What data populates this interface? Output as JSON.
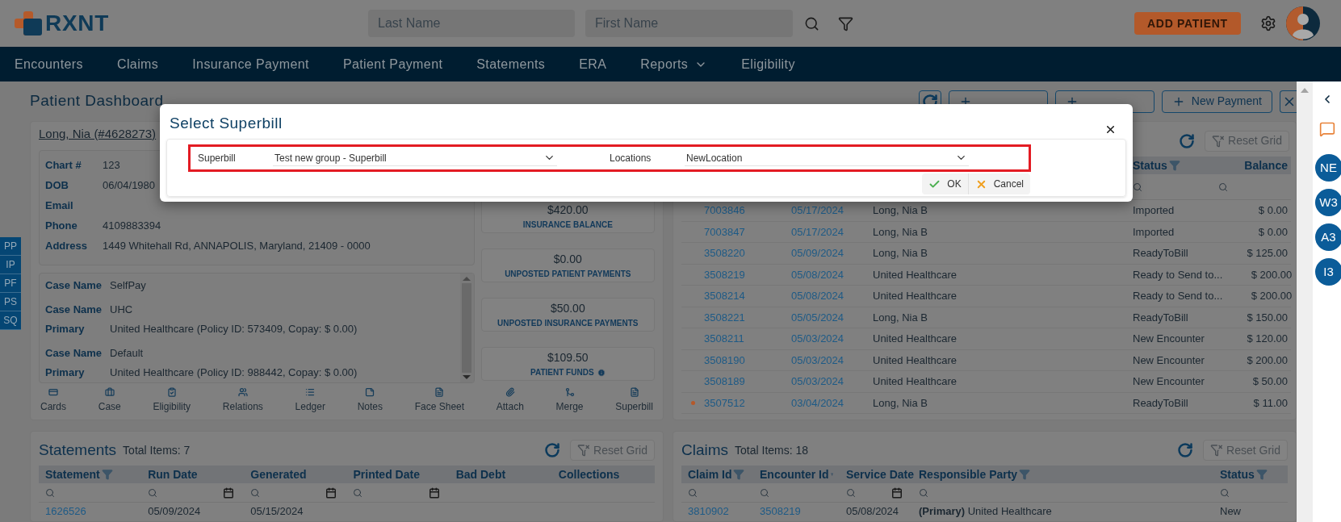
{
  "header": {
    "logo": "RXNT",
    "last_name": {
      "placeholder": "Last Name"
    },
    "first_name": {
      "placeholder": "First Name"
    },
    "add_patient": "ADD PATIENT"
  },
  "nav": [
    {
      "label": "Encounters",
      "dropdown": false
    },
    {
      "label": "Claims",
      "dropdown": false
    },
    {
      "label": "Insurance Payment",
      "dropdown": false
    },
    {
      "label": "Patient Payment",
      "dropdown": false
    },
    {
      "label": "Statements",
      "dropdown": false
    },
    {
      "label": "ERA",
      "dropdown": false
    },
    {
      "label": "Reports",
      "dropdown": true
    },
    {
      "label": "Eligibility",
      "dropdown": false
    }
  ],
  "side_tabs": [
    "PP",
    "IP",
    "PF",
    "PS",
    "SQ"
  ],
  "page": {
    "title": "Patient Dashboard",
    "actions": [
      {
        "covered": true
      },
      {
        "covered": true
      },
      {
        "label": "New Payment",
        "covered": false
      }
    ]
  },
  "patient": {
    "name": "Long, Nia (#4628273)",
    "fields": [
      {
        "label": "Chart #",
        "value": "123"
      },
      {
        "label": "DOB",
        "value": "06/04/1980"
      },
      {
        "label": "Email"
      },
      {
        "label": "Phone",
        "value": "4109883394"
      },
      {
        "label": "Address",
        "value": "1449 Whitehall Rd, ANNAPOLIS, Maryland, 21409 - 0000"
      }
    ],
    "cases": [
      {
        "rows": [
          {
            "label": "Case Name",
            "value": "SelfPay"
          }
        ]
      },
      {
        "rows": [
          {
            "label": "Case Name",
            "value": "UHC"
          },
          {
            "label": "Primary",
            "value": "United Healthcare (Policy ID: 573409, Copay: $ 0.00)"
          }
        ]
      },
      {
        "rows": [
          {
            "label": "Case Name",
            "value": "Default"
          },
          {
            "label": "Primary",
            "value": "United Healthcare (Policy ID: 988442, Copay: $ 0.00)"
          }
        ]
      }
    ],
    "balances": [
      {
        "amount": "$420.00",
        "label": "INSURANCE BALANCE",
        "info": false
      },
      {
        "amount": "$0.00",
        "label": "UNPOSTED PATIENT PAYMENTS",
        "info": false
      },
      {
        "amount": "$50.00",
        "label": "UNPOSTED INSURANCE PAYMENTS",
        "info": false
      },
      {
        "amount": "$109.50",
        "label": "PATIENT FUNDS",
        "info": true
      }
    ],
    "actions": [
      {
        "label": "Cards",
        "kind": "card"
      },
      {
        "label": "Case",
        "kind": "case"
      },
      {
        "label": "Eligibility",
        "kind": "eligibility"
      },
      {
        "label": "Relations",
        "kind": "relations"
      },
      {
        "label": "Ledger",
        "kind": "ledger"
      },
      {
        "label": "Notes",
        "kind": "notes"
      },
      {
        "label": "Face Sheet",
        "kind": "document"
      },
      {
        "label": "Attach",
        "kind": "attach"
      },
      {
        "label": "Merge",
        "kind": "merge"
      },
      {
        "label": "Superbill",
        "kind": "document"
      }
    ]
  },
  "encounters": {
    "reset_label": "Reset Grid",
    "columns": [
      {
        "label": "Status",
        "filter": true
      },
      {
        "label": "Balance",
        "filter": false
      }
    ],
    "rows": [
      {
        "id": "7003846",
        "date": "05/17/2024",
        "party": "Long, Nia B",
        "status": "Imported",
        "balance": "$ 0.00",
        "flag": false
      },
      {
        "id": "7003847",
        "date": "05/17/2024",
        "party": "Long, Nia B",
        "status": "Imported",
        "balance": "$ 0.00",
        "flag": false
      },
      {
        "id": "3508220",
        "date": "05/09/2024",
        "party": "Long, Nia B",
        "status": "ReadyToBill",
        "balance": "$ 125.00",
        "flag": false
      },
      {
        "id": "3508219",
        "date": "05/08/2024",
        "party": "United Healthcare",
        "status": "Ready to Send to...",
        "balance": "$ 200.00",
        "flag": false
      },
      {
        "id": "3508214",
        "date": "05/08/2024",
        "party": "United Healthcare",
        "status": "Ready to Send to...",
        "balance": "$ 200.00",
        "flag": false
      },
      {
        "id": "3508221",
        "date": "05/05/2024",
        "party": "Long, Nia B",
        "status": "ReadyToBill",
        "balance": "$ 150.00",
        "flag": false
      },
      {
        "id": "3508211",
        "date": "05/03/2024",
        "party": "United Healthcare",
        "status": "New Encounter",
        "balance": "$ 120.00",
        "flag": false
      },
      {
        "id": "3508190",
        "date": "05/03/2024",
        "party": "United Healthcare",
        "status": "New Encounter",
        "balance": "$ 200.00",
        "flag": false
      },
      {
        "id": "3508189",
        "date": "05/03/2024",
        "party": "United Healthcare",
        "status": "New Encounter",
        "balance": "$ 50.00",
        "flag": false
      },
      {
        "id": "3507512",
        "date": "03/04/2024",
        "party": "Long, Nia B",
        "status": "ReadyToBill",
        "balance": "$ 11.00",
        "flag": true
      }
    ]
  },
  "statements": {
    "title": "Statements",
    "total": "Total Items: 7",
    "reset_label": "Reset Grid",
    "columns": [
      {
        "label": "Statement",
        "filter": true,
        "search": true,
        "date": false
      },
      {
        "label": "Run Date",
        "filter": false,
        "search": true,
        "date": true
      },
      {
        "label": "Generated",
        "filter": false,
        "search": true,
        "date": true
      },
      {
        "label": "Printed Date",
        "filter": false,
        "search": true,
        "date": true
      },
      {
        "label": "Bad Debt",
        "filter": false,
        "search": false,
        "date": false
      },
      {
        "label": "Collections",
        "filter": false,
        "search": false,
        "date": false
      }
    ],
    "rows": [
      {
        "cells": [
          "1626526",
          "05/09/2024",
          "05/15/2024"
        ]
      }
    ]
  },
  "claims": {
    "title": "Claims",
    "total": "Total Items: 18",
    "reset_label": "Reset Grid",
    "columns": [
      {
        "label": "Claim Id",
        "filter": true,
        "search": true,
        "date": false
      },
      {
        "label": "Encounter Id",
        "filter": true,
        "search": true,
        "date": false
      },
      {
        "label": "Service Date",
        "filter": false,
        "search": true,
        "date": true
      },
      {
        "label": "Responsible Party",
        "filter": true,
        "search": true,
        "date": false
      },
      {
        "label": "Status",
        "filter": true,
        "search": true,
        "date": false
      }
    ],
    "rows": [
      {
        "cells": [
          "3810902",
          "3508219",
          "05/08/2024",
          "**(Primary)** United Healthcare",
          "New"
        ]
      }
    ]
  },
  "right_sidebar": {
    "badges": [
      "NE",
      "W3",
      "A3",
      "I3"
    ]
  },
  "modal": {
    "title": "Select Superbill",
    "fields": [
      {
        "label": "Superbill",
        "value": "Test new group - Superbill"
      },
      {
        "label": "Locations",
        "value": "NewLocation"
      }
    ],
    "ok": "OK",
    "cancel": "Cancel"
  }
}
